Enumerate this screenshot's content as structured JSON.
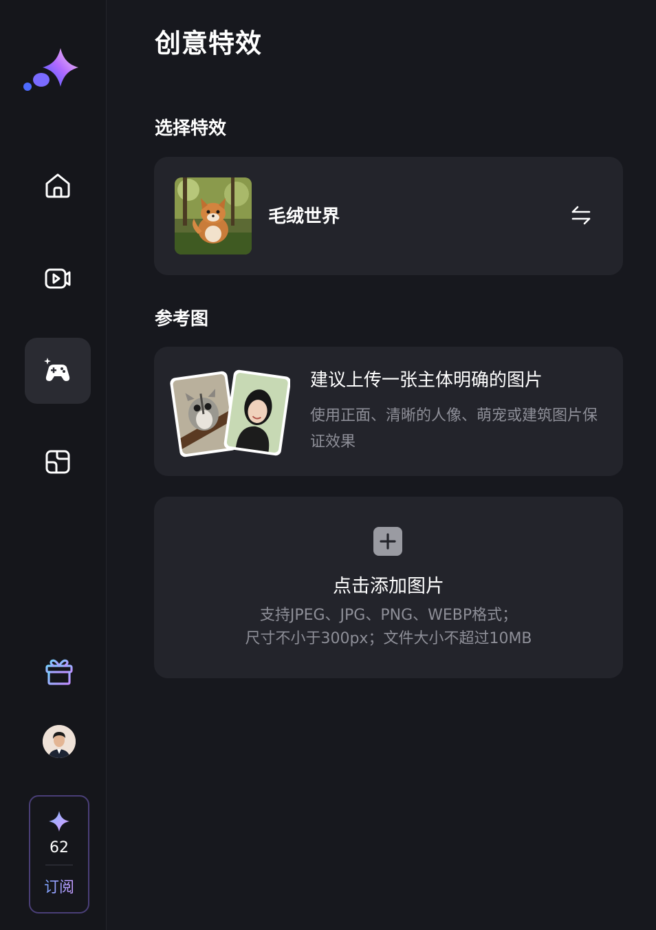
{
  "page": {
    "title": "创意特效"
  },
  "sections": {
    "effect_label": "选择特效",
    "reference_label": "参考图"
  },
  "effect": {
    "name": "毛绒世界",
    "thumbnail_icon": "plush-fox-thumbnail",
    "swap_icon": "swap-arrows-icon"
  },
  "reference": {
    "title": "建议上传一张主体明确的图片",
    "description": "使用正面、清晰的人像、萌宠或建筑图片保证效果"
  },
  "upload": {
    "title": "点击添加图片",
    "line1": "支持JPEG、JPG、PNG、WEBP格式；",
    "line2": "尺寸不小于300px；文件大小不超过10MB"
  },
  "sidebar": {
    "items": [
      {
        "icon": "home-icon",
        "active": false
      },
      {
        "icon": "video-icon",
        "active": false
      },
      {
        "icon": "game-effects-icon",
        "active": true
      },
      {
        "icon": "gallery-icon",
        "active": false
      }
    ],
    "credits": {
      "count": "62",
      "subscribe_label": "订阅"
    }
  },
  "colors": {
    "background": "#17181e",
    "card": "#23242b",
    "accent_start": "#7aa4ff",
    "accent_end": "#c69bff",
    "muted_text": "#8e8f98"
  }
}
